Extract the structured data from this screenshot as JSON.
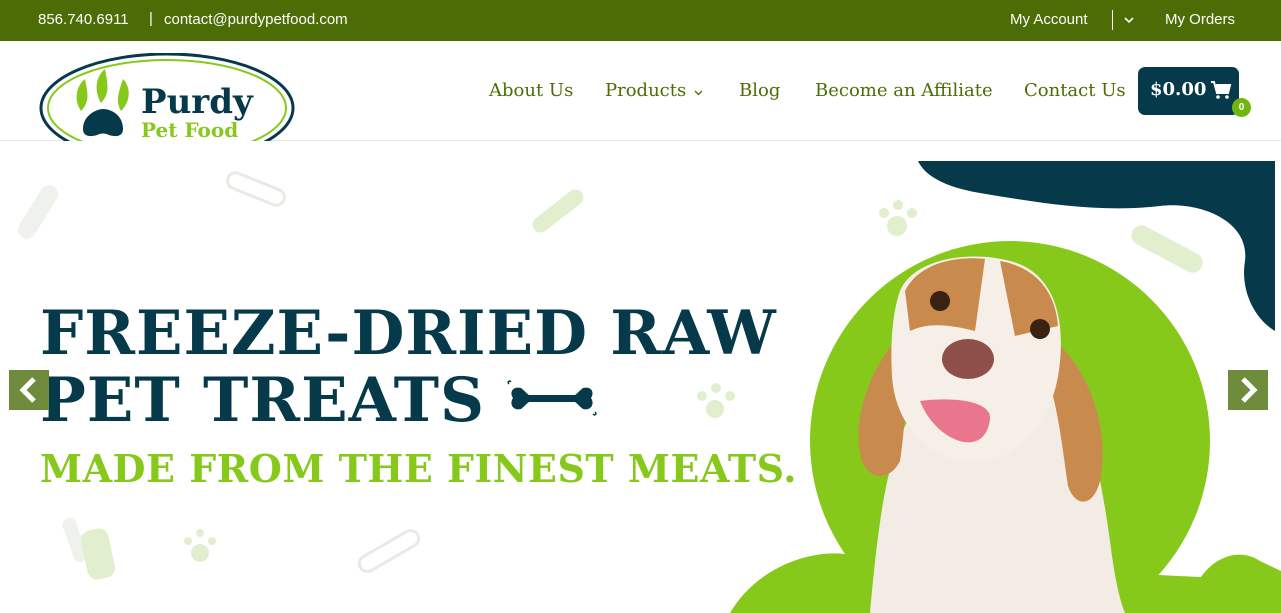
{
  "topbar": {
    "phone": "856.740.6911",
    "separator": "|",
    "email": "contact@purdypetfood.com",
    "my_account": "My Account",
    "my_orders": "My Orders"
  },
  "logo": {
    "line1": "Purdy",
    "line2": "Pet Food"
  },
  "nav": {
    "about": "About Us",
    "products": "Products",
    "blog": "Blog",
    "affiliate": "Become an Affiliate",
    "contact": "Contact Us"
  },
  "cart": {
    "amount": "$0.00",
    "count": "0",
    "icon": "shopping-cart-icon"
  },
  "hero": {
    "headline_line1": "FREEZE-DRIED RAW",
    "headline_line2": "PET TREATS",
    "subheadline": "MADE FROM THE FINEST MEATS.",
    "prev_icon": "chevron-left-icon",
    "next_icon": "chevron-right-icon"
  },
  "colors": {
    "topbar": "#4c6c06",
    "nav_text": "#4c6c06",
    "navy": "#063a4a",
    "lime": "#86c91b",
    "slider_arrow": "#6f8c3d"
  }
}
